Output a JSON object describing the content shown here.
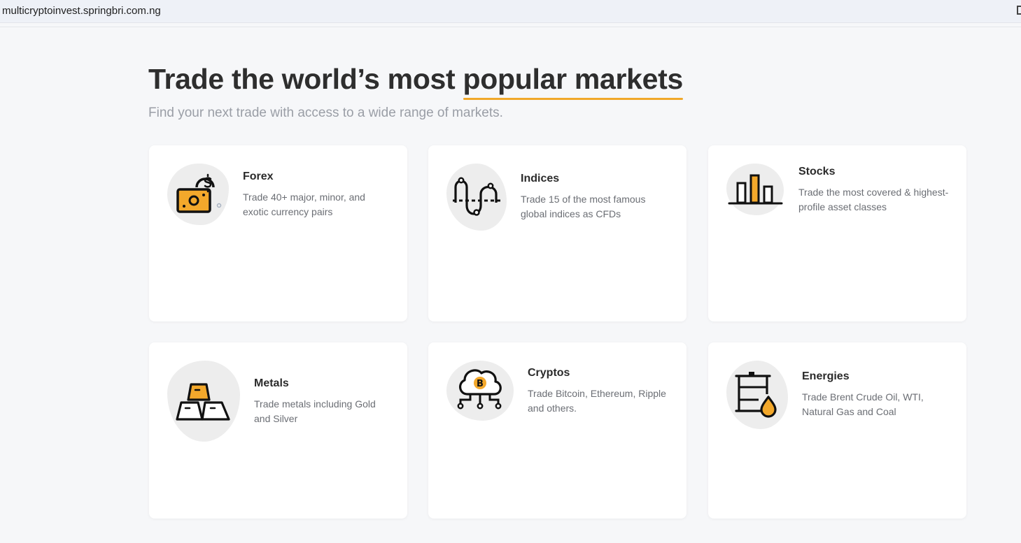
{
  "browser": {
    "url": "multicryptoinvest.springbri.com.ng"
  },
  "hero": {
    "title_pre": "Trade the world’s most ",
    "title_highlight": "popular markets",
    "subtitle": "Find your next trade with access to a wide range of markets."
  },
  "markets": [
    {
      "icon": "money-dollar-icon",
      "title": "Forex",
      "desc": "Trade 40+ major, minor, and exotic currency pairs"
    },
    {
      "icon": "wave-chart-icon",
      "title": "Indices",
      "desc": "Trade 15 of the most famous global indices as CFDs"
    },
    {
      "icon": "bar-chart-icon",
      "title": "Stocks",
      "desc": "Trade the most covered & highest-profile asset classes"
    },
    {
      "icon": "gold-bars-icon",
      "title": "Metals",
      "desc": "Trade metals including Gold and Silver"
    },
    {
      "icon": "bitcoin-cloud-icon",
      "title": "Cryptos",
      "desc": "Trade Bitcoin, Ethereum, Ripple and others."
    },
    {
      "icon": "oil-barrel-icon",
      "title": "Energies",
      "desc": "Trade Brent Crude Oil, WTI, Natural Gas and Coal"
    }
  ],
  "colors": {
    "accent": "#f0a82a",
    "icon_stroke": "#111111",
    "blob": "#ededed",
    "background": "#f6f7f9"
  }
}
